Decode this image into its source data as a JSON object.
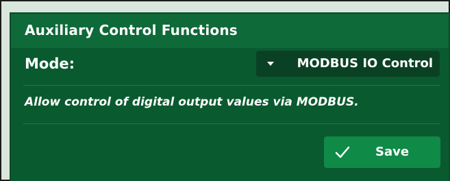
{
  "panel": {
    "title": "Auxiliary Control Functions",
    "mode": {
      "label": "Mode:",
      "selected": "MODBUS IO Control"
    },
    "description": "Allow control of digital output values via MODBUS.",
    "save": {
      "label": "Save",
      "icon": "check-icon"
    }
  },
  "colors": {
    "panel_bg": "#0a5a2f",
    "header_bg": "#0e6a38",
    "select_bg": "#0a4124",
    "button_bg": "#0f8a47",
    "text": "#ffffff"
  }
}
